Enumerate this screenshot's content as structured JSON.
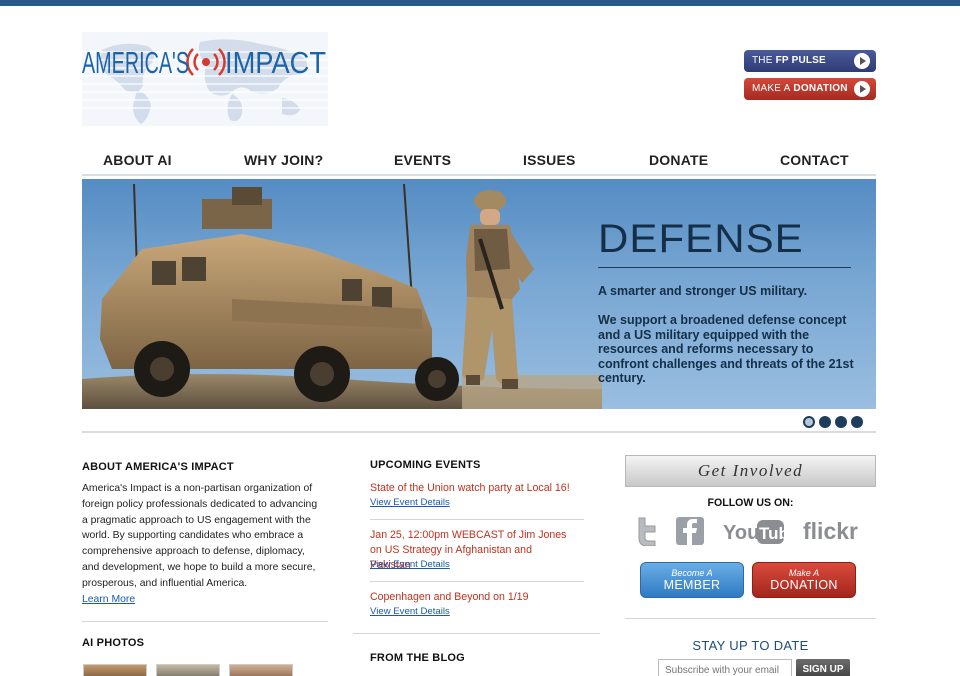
{
  "logo": {
    "text_left": "AMERICA'S",
    "text_right": "IMPACT"
  },
  "header_buttons": {
    "pulse_prefix": "THE",
    "pulse_bold": "FP PULSE",
    "donate_prefix": "MAKE A",
    "donate_bold": "DONATION"
  },
  "nav": [
    "ABOUT AI",
    "WHY JOIN?",
    "EVENTS",
    "ISSUES",
    "DONATE",
    "CONTACT"
  ],
  "hero": {
    "title": "DEFENSE",
    "tagline": "A smarter and stronger US military.",
    "body": "We support a broadened defense concept and a US military equipped with the resources and reforms necessary to confront challenges and threats of the 21st century.",
    "slide_count": 4,
    "active_slide": 1
  },
  "about": {
    "heading": "ABOUT AMERICA'S IMPACT",
    "body": "America's Impact is a non-partisan organization of foreign policy professionals dedicated to advancing a pragmatic approach to US engagement with the world. By supporting candidates who embrace a comprehensive approach to defense, diplomacy, and development, we hope to build a more secure, prosperous, and influential America.",
    "learn_more": "Learn More"
  },
  "photos": {
    "heading": "AI PHOTOS"
  },
  "events": {
    "heading": "UPCOMING EVENTS",
    "items": [
      {
        "title": "State of the Union watch party at Local 16!",
        "link": "View Event Details"
      },
      {
        "title": "Jan 25, 12:00pm WEBCAST of Jim Jones on US Strategy in Afghanistan and Pakistan",
        "link": "View Event Details"
      },
      {
        "title": "Copenhagen and Beyond on 1/19",
        "link": "View Event Details"
      }
    ]
  },
  "blog": {
    "heading": "FROM THE BLOG"
  },
  "sidebar": {
    "get_involved": "Get Involved",
    "follow": "FOLLOW US ON:",
    "social": [
      "twitter",
      "facebook",
      "YouTube",
      "flickr"
    ],
    "member_small": "Become A",
    "member_large": "MEMBER",
    "donation_small": "Make A",
    "donation_large": "DONATION",
    "stay": "STAY UP TO DATE",
    "subscribe_placeholder": "Subscribe with your email",
    "signup": "SIGN UP"
  },
  "colors": {
    "brand_blue": "#1c64a8",
    "accent_red": "#c0321f",
    "link_blue": "#1b58b0"
  }
}
